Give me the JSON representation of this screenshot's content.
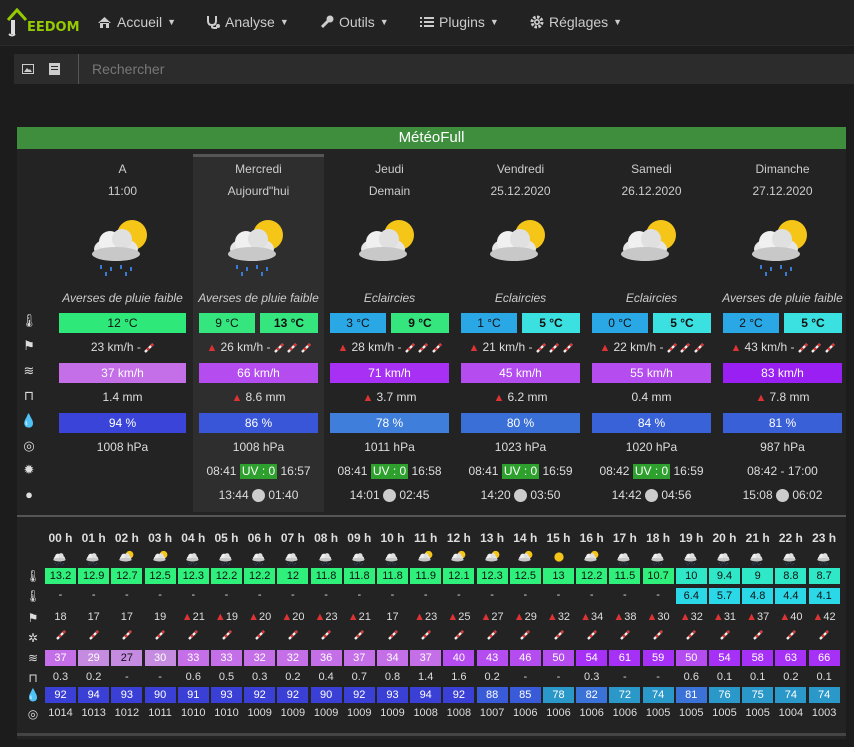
{
  "app": {
    "logo_text": "EEDOM"
  },
  "nav": [
    {
      "label": "Accueil",
      "icon": "home-icon"
    },
    {
      "label": "Analyse",
      "icon": "stethoscope-icon"
    },
    {
      "label": "Outils",
      "icon": "wrench-icon"
    },
    {
      "label": "Plugins",
      "icon": "list-icon"
    },
    {
      "label": "Réglages",
      "icon": "gear-icon"
    }
  ],
  "search": {
    "placeholder": "Rechercher"
  },
  "widget": {
    "title": "MétéoFull"
  },
  "days": [
    {
      "name": "A",
      "date": "11:00",
      "cond": "Averses de pluie faible",
      "icon": "cloud-sun-rain-icon",
      "temp_min": "12 °C",
      "temp_max": null,
      "wind": "23 km/h -",
      "wind_warn": false,
      "gust": "37 km/h",
      "rain": "1.4 mm",
      "rain_warn": false,
      "hum": "94 %",
      "press": "1008 hPa",
      "sunrise": null,
      "sunset": null,
      "moonrise": null,
      "moonset": null
    },
    {
      "name": "Mercredi",
      "date": "Aujourd\"hui",
      "cond": "Averses de pluie faible",
      "icon": "cloud-sun-rain-icon",
      "temp_min": "9 °C",
      "temp_max": "13 °C",
      "wind": "26 km/h -",
      "wind_warn": true,
      "gust": "66 km/h",
      "rain": "8.6 mm",
      "rain_warn": true,
      "hum": "86 %",
      "press": "1008 hPa",
      "sunrise": "08:41",
      "uv": "UV : 0",
      "sunset": "16:57",
      "moonrise": "13:44",
      "moonset": "01:40"
    },
    {
      "name": "Jeudi",
      "date": "Demain",
      "cond": "Eclaircies",
      "icon": "cloud-sun-icon",
      "temp_min": "3 °C",
      "temp_max": "9 °C",
      "wind": "28 km/h -",
      "wind_warn": true,
      "gust": "71 km/h",
      "rain": "3.7 mm",
      "rain_warn": true,
      "hum": "78 %",
      "press": "1011 hPa",
      "sunrise": "08:41",
      "uv": "UV : 0",
      "sunset": "16:58",
      "moonrise": "14:01",
      "moonset": "02:45"
    },
    {
      "name": "Vendredi",
      "date": "25.12.2020",
      "cond": "Eclaircies",
      "icon": "cloud-sun-icon",
      "temp_min": "1 °C",
      "temp_max": "5 °C",
      "wind": "21 km/h -",
      "wind_warn": true,
      "gust": "45 km/h",
      "rain": "6.2 mm",
      "rain_warn": true,
      "hum": "80 %",
      "press": "1023 hPa",
      "sunrise": "08:41",
      "uv": "UV : 0",
      "sunset": "16:59",
      "moonrise": "14:20",
      "moonset": "03:50"
    },
    {
      "name": "Samedi",
      "date": "26.12.2020",
      "cond": "Eclaircies",
      "icon": "cloud-sun-icon",
      "temp_min": "0 °C",
      "temp_max": "5 °C",
      "wind": "22 km/h -",
      "wind_warn": true,
      "gust": "55 km/h",
      "rain": "0.4 mm",
      "rain_warn": false,
      "hum": "84 %",
      "press": "1020 hPa",
      "sunrise": "08:42",
      "uv": "UV : 0",
      "sunset": "16:59",
      "moonrise": "14:42",
      "moonset": "04:56"
    },
    {
      "name": "Dimanche",
      "date": "27.12.2020",
      "cond": "Averses de pluie faible",
      "icon": "cloud-sun-rain-icon",
      "temp_min": "2 °C",
      "temp_max": "5 °C",
      "wind": "43 km/h -",
      "wind_warn": true,
      "gust": "83 km/h",
      "rain": "7.8 mm",
      "rain_warn": true,
      "hum": "81 %",
      "press": "987 hPa",
      "sunrise_sunset": "08:42 - 17:00",
      "moonrise": "15:08",
      "moonset": "06:02"
    }
  ],
  "hourly": {
    "hours": [
      "00 h",
      "01 h",
      "02 h",
      "03 h",
      "04 h",
      "05 h",
      "06 h",
      "07 h",
      "08 h",
      "09 h",
      "10 h",
      "11 h",
      "12 h",
      "13 h",
      "14 h",
      "15 h",
      "16 h",
      "17 h",
      "18 h",
      "19 h",
      "20 h",
      "21 h",
      "22 h",
      "23 h"
    ],
    "icons": [
      "cloud-rain-icon",
      "cloud-rain-icon",
      "cloud-sun-icon",
      "cloud-sun-icon",
      "cloud-rain-icon",
      "cloud-rain-icon",
      "cloud-rain-icon",
      "cloud-rain-icon",
      "cloud-rain-icon",
      "cloud-rain-icon",
      "cloud-rain-icon",
      "cloud-sun-icon",
      "cloud-sun-icon",
      "cloud-sun-icon",
      "cloud-sun-icon",
      "sun-icon",
      "cloud-sun-icon",
      "cloud-rain-icon",
      "cloud-rain-icon",
      "cloud-rain-icon",
      "cloud-rain-icon",
      "cloud-rain-icon",
      "cloud-rain-icon",
      "cloud-rain-icon"
    ],
    "temp": [
      "13.2",
      "12.9",
      "12.7",
      "12.5",
      "12.3",
      "12.2",
      "12.2",
      "12",
      "11.8",
      "11.8",
      "11.8",
      "11.9",
      "12.1",
      "12.3",
      "12.5",
      "13",
      "12.2",
      "11.5",
      "10.7",
      "10",
      "9.4",
      "9",
      "8.8",
      "8.7"
    ],
    "temp2": [
      "-",
      "-",
      "-",
      "-",
      "-",
      "-",
      "-",
      "-",
      "-",
      "-",
      "-",
      "-",
      "-",
      "-",
      "-",
      "-",
      "-",
      "-",
      "-",
      "6.4",
      "5.7",
      "4.8",
      "4.4",
      "4.1"
    ],
    "wind": [
      "18",
      "17",
      "17",
      "19",
      "21",
      "19",
      "20",
      "20",
      "23",
      "21",
      "17",
      "23",
      "25",
      "27",
      "29",
      "32",
      "34",
      "38",
      "30",
      "32",
      "31",
      "37",
      "40",
      "42"
    ],
    "wind_warn": [
      false,
      false,
      false,
      false,
      true,
      true,
      true,
      true,
      true,
      true,
      false,
      true,
      true,
      true,
      true,
      true,
      true,
      true,
      true,
      true,
      true,
      true,
      true,
      true
    ],
    "gust": [
      "37",
      "29",
      "27",
      "30",
      "33",
      "33",
      "32",
      "32",
      "36",
      "37",
      "34",
      "37",
      "40",
      "43",
      "46",
      "50",
      "54",
      "61",
      "59",
      "50",
      "54",
      "58",
      "63",
      "66"
    ],
    "rain": [
      "0.3",
      "0.2",
      "-",
      "-",
      "0.6",
      "0.5",
      "0.3",
      "0.2",
      "0.4",
      "0.7",
      "0.8",
      "1.4",
      "1.6",
      "0.2",
      "-",
      "-",
      "0.3",
      "-",
      "-",
      "0.6",
      "0.1",
      "0.1",
      "0.2",
      "0.1"
    ],
    "hum": [
      "92",
      "94",
      "93",
      "90",
      "91",
      "93",
      "92",
      "92",
      "90",
      "92",
      "93",
      "94",
      "92",
      "88",
      "85",
      "78",
      "82",
      "72",
      "74",
      "81",
      "76",
      "75",
      "74",
      "74"
    ],
    "press": [
      "1014",
      "1013",
      "1012",
      "1011",
      "1010",
      "1010",
      "1009",
      "1009",
      "1009",
      "1009",
      "1009",
      "1008",
      "1008",
      "1007",
      "1006",
      "1006",
      "1006",
      "1006",
      "1005",
      "1005",
      "1005",
      "1005",
      "1004",
      "1003"
    ]
  }
}
